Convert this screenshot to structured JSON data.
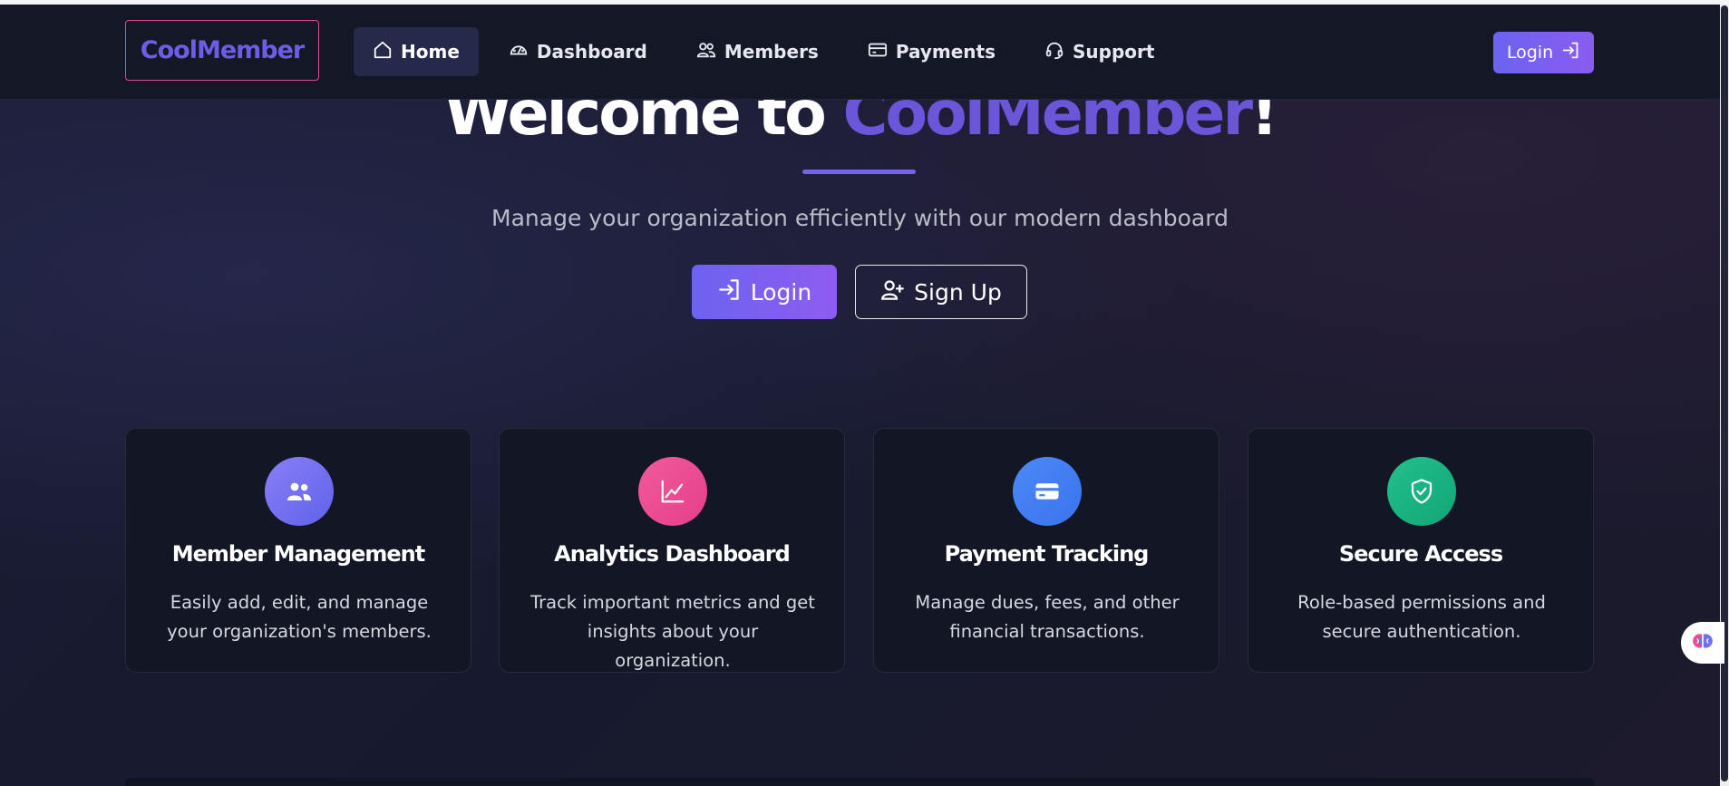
{
  "brand": {
    "name": "CoolMember"
  },
  "nav": {
    "items": [
      {
        "label": "Home",
        "icon": "home-icon",
        "active": true
      },
      {
        "label": "Dashboard",
        "icon": "speedometer-icon",
        "active": false
      },
      {
        "label": "Members",
        "icon": "people-icon",
        "active": false
      },
      {
        "label": "Payments",
        "icon": "credit-card-icon",
        "active": false
      },
      {
        "label": "Support",
        "icon": "headset-icon",
        "active": false
      }
    ],
    "login_label": "Login"
  },
  "hero": {
    "title_prefix": "Welcome to ",
    "title_accent": "CoolMember",
    "title_suffix": "!",
    "subtitle": "Manage your organization efficiently with our modern dashboard",
    "primary_button": "Login",
    "secondary_button": "Sign Up"
  },
  "features": [
    {
      "title": "Member Management",
      "description": "Easily add, edit, and manage your organization's members.",
      "icon": "people-icon",
      "color": "#6f6ef0"
    },
    {
      "title": "Analytics Dashboard",
      "description": "Track important metrics and get insights about your organization.",
      "icon": "chart-line-icon",
      "color": "#e94b91"
    },
    {
      "title": "Payment Tracking",
      "description": "Manage dues, fees, and other financial transactions.",
      "icon": "credit-card-icon",
      "color": "#4180f2"
    },
    {
      "title": "Secure Access",
      "description": "Role-based permissions and secure authentication.",
      "icon": "shield-check-icon",
      "color": "#18b180"
    }
  ],
  "colors": {
    "accent": "#6b55d9",
    "brand_border": "#e1459c",
    "background": "#171a2e"
  }
}
